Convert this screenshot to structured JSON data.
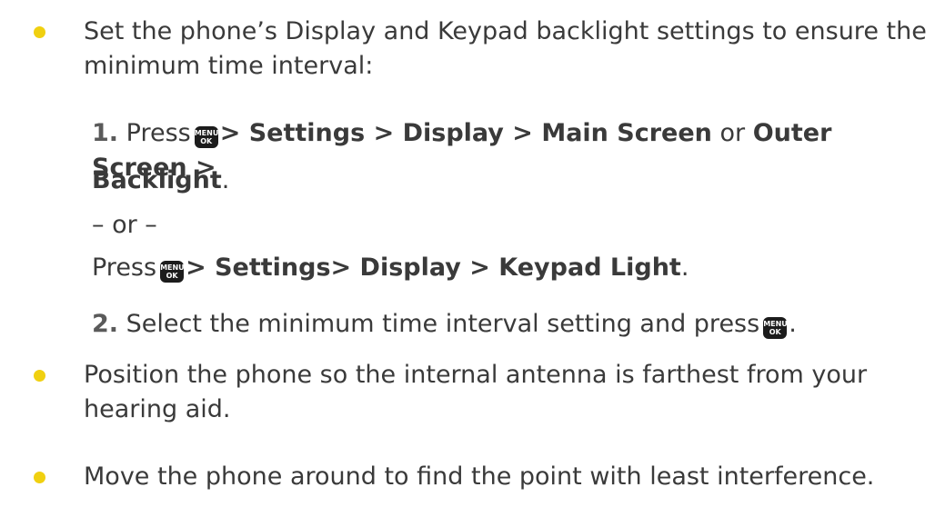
{
  "bullet_color": "#f0d010",
  "menu_key": {
    "top": "MENU",
    "bottom": "OK",
    "icon": "menu-ok-key-icon"
  },
  "bullets": [
    {
      "line1": "Set the phone’s Display and Keypad backlight settings to ensure the",
      "line2": "minimum time interval:"
    },
    {
      "line1": "Position the phone so the internal antenna is farthest from your",
      "line2": "hearing aid."
    },
    {
      "line1": "Move the phone around to find the point with least interference."
    }
  ],
  "step1": {
    "number": "1.",
    "press": "Press",
    "path1": "> Settings > Display > Main Screen",
    "or_word": "or",
    "path2": "Outer Screen >",
    "path3": "Backlight",
    "period": ".",
    "alt": "– or –",
    "press2": "Press",
    "path4": "> Settings> Display > Keypad Light",
    "period2": "."
  },
  "step2": {
    "number": "2.",
    "text": "Select the minimum time interval setting and press",
    "period": "."
  }
}
